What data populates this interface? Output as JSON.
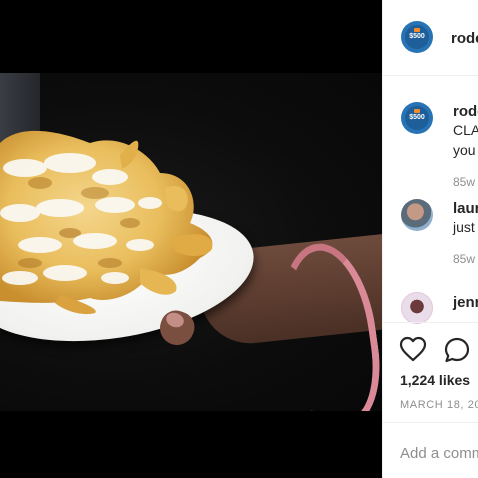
{
  "header": {
    "username": "rode"
  },
  "comments": [
    {
      "avatar": "rodeo-avatar",
      "avatar_text": "$500",
      "username": "rode",
      "lines": [
        "CLA",
        "you"
      ],
      "time": "85w"
    },
    {
      "avatar": "laur-avatar",
      "username": "laur",
      "lines": [
        "just"
      ],
      "time": "85w"
    },
    {
      "avatar": "jenn-avatar",
      "username": "jenn",
      "lines": [],
      "time": ""
    }
  ],
  "actions": {
    "like_icon": "heart-icon",
    "comment_icon": "comment-icon"
  },
  "likes_text": "1,224 likes",
  "date": "MARCH 18, 20",
  "add_comment_placeholder": "Add a comm",
  "colors": {
    "brand_blue": "#2773b5",
    "text": "#262626",
    "muted": "#8e8e8e",
    "divider": "#efefef"
  }
}
